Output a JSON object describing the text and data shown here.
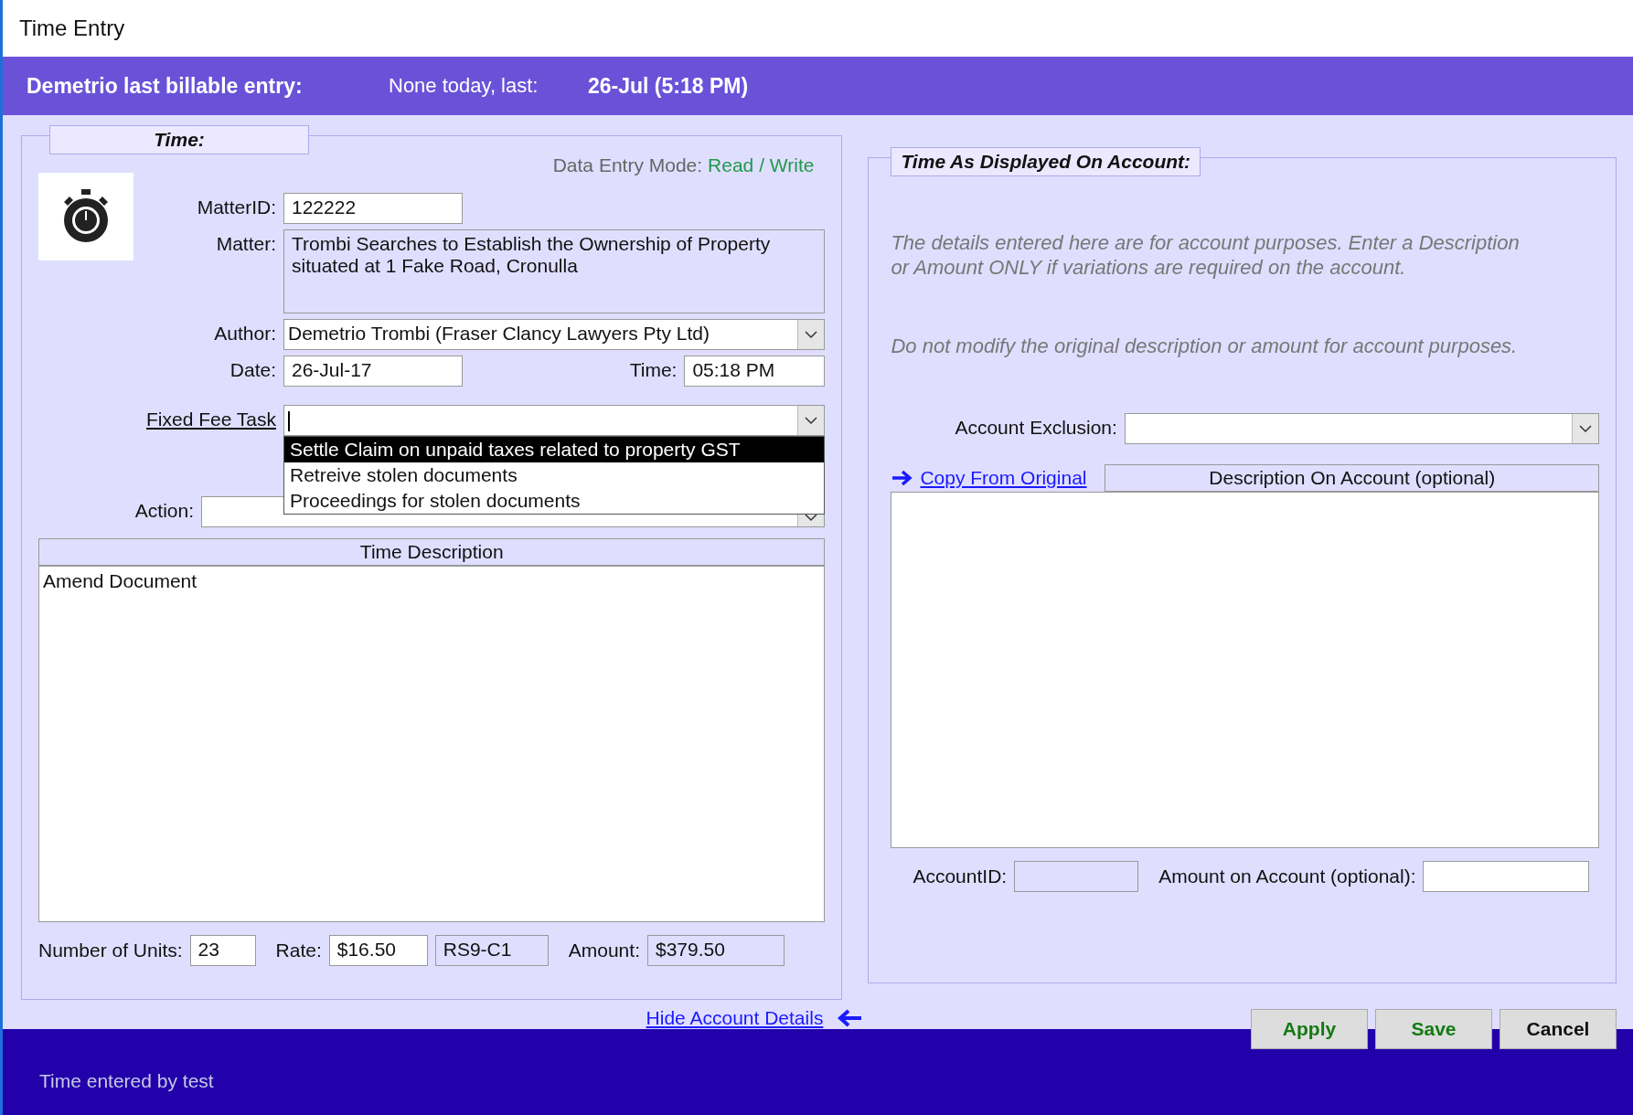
{
  "window": {
    "title": "Time Entry"
  },
  "header": {
    "label": "Demetrio last billable entry:",
    "note": "None today, last:",
    "value": "26-Jul (5:18 PM)"
  },
  "time_panel": {
    "title": "Time:",
    "mode_label": "Data Entry Mode:",
    "mode_value": "Read / Write",
    "fields": [
      {
        "kind": "text",
        "label": "MatterID:",
        "value": "122222"
      },
      {
        "kind": "memo",
        "label": "Matter:",
        "value": "Trombi Searches to Establish the Ownership of Property situated at 1 Fake Road, Cronulla"
      },
      {
        "kind": "combo",
        "label": "Author:",
        "value": "Demetrio Trombi (Fraser Clancy Lawyers Pty Ltd)"
      }
    ],
    "date": {
      "label": "Date:",
      "value": "26-Jul-17"
    },
    "time": {
      "label": "Time:",
      "value": "05:18 PM"
    },
    "fixed_fee": {
      "label": "Fixed Fee Task",
      "expanded": true,
      "options": [
        {
          "label": "Settle Claim on unpaid taxes related to property GST",
          "selected": true
        },
        {
          "label": "Retreive stolen documents",
          "selected": false
        },
        {
          "label": "Proceedings for stolen documents",
          "selected": false
        }
      ]
    },
    "action": {
      "label": "Action:"
    },
    "description": {
      "header": "Time Description",
      "value": "Amend Document"
    },
    "units": {
      "label": "Number of Units:",
      "value": "23"
    },
    "rate": {
      "label": "Rate:",
      "value": "$16.50",
      "code": "RS9-C1"
    },
    "amount": {
      "label": "Amount:",
      "value": "$379.50"
    }
  },
  "account_panel": {
    "title": "Time As Displayed On Account:",
    "notes": [
      "The details entered here are for account purposes. Enter a Description or Amount ONLY if variations are required on the account.",
      "Do not modify the original description or amount for account purposes."
    ],
    "exclusion": {
      "label": "Account Exclusion:"
    },
    "copy_link": "Copy From Original",
    "description_header": "Description On Account (optional)",
    "account_id": {
      "label": "AccountID:"
    },
    "amount": {
      "label": "Amount on Account (optional):"
    }
  },
  "hide_link": "Hide Account Details",
  "buttons": [
    {
      "label": "Apply",
      "kind": "green"
    },
    {
      "label": "Save",
      "kind": "green"
    },
    {
      "label": "Cancel",
      "kind": "plain"
    }
  ],
  "status_bar": "Time entered by test"
}
